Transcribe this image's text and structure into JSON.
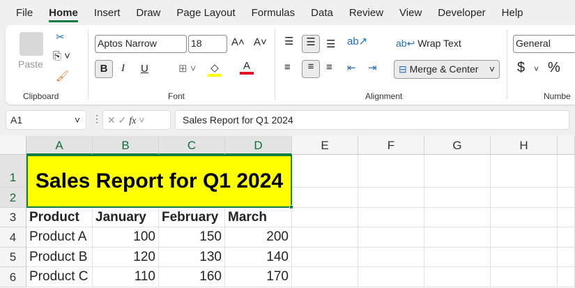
{
  "menu": [
    "File",
    "Home",
    "Insert",
    "Draw",
    "Page Layout",
    "Formulas",
    "Data",
    "Review",
    "View",
    "Developer",
    "Help"
  ],
  "ribbon": {
    "clipboard": {
      "paste": "Paste",
      "label": "Clipboard"
    },
    "font": {
      "name": "Aptos Narrow",
      "size": "18",
      "bold": "B",
      "italic": "I",
      "underline": "U",
      "label": "Font",
      "fill_color": "#ffff00",
      "font_color": "#e81123"
    },
    "alignment": {
      "wrap": "Wrap Text",
      "merge": "Merge & Center",
      "label": "Alignment"
    },
    "number": {
      "format": "General",
      "currency": "$",
      "percent": "%",
      "label": "Numbe"
    }
  },
  "formula_bar": {
    "name_box": "A1",
    "fx": "fx",
    "value": "Sales Report for Q1 2024"
  },
  "columns": [
    "A",
    "B",
    "C",
    "D",
    "E",
    "F",
    "G",
    "H"
  ],
  "rows": [
    "1",
    "2",
    "3",
    "4",
    "5",
    "6"
  ],
  "sheet": {
    "title": "Sales Report for Q1 2024",
    "headers": [
      "Product",
      "January",
      "February",
      "March"
    ],
    "data": [
      [
        "Product A",
        "100",
        "150",
        "200"
      ],
      [
        "Product B",
        "120",
        "130",
        "140"
      ],
      [
        "Product C",
        "110",
        "160",
        "170"
      ]
    ]
  }
}
